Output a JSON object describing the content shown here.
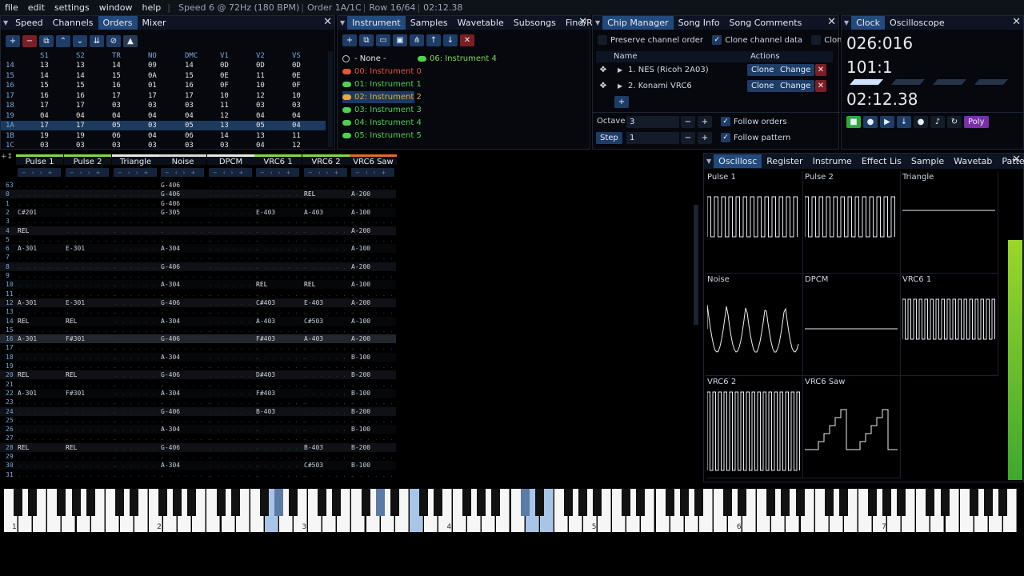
{
  "menu": {
    "items": [
      "file",
      "edit",
      "settings",
      "window",
      "help"
    ],
    "status": [
      "Speed 6 @ 72Hz (180 BPM)",
      "Order 1A/1C",
      "Row 16/64",
      "02:12.38"
    ]
  },
  "orders_panel": {
    "tabs": [
      "Speed",
      "Channels",
      "Orders",
      "Mixer"
    ],
    "columns": [
      "S1",
      "S2",
      "TR",
      "NO",
      "DMC",
      "V1",
      "V2",
      "VS"
    ],
    "rows": [
      {
        "num": "14",
        "vals": [
          "13",
          "13",
          "14",
          "09",
          "14",
          "0D",
          "0D",
          "0D"
        ]
      },
      {
        "num": "15",
        "vals": [
          "14",
          "14",
          "15",
          "0A",
          "15",
          "0E",
          "11",
          "0E"
        ]
      },
      {
        "num": "16",
        "vals": [
          "15",
          "15",
          "16",
          "01",
          "16",
          "0F",
          "10",
          "0F"
        ]
      },
      {
        "num": "17",
        "vals": [
          "16",
          "16",
          "17",
          "17",
          "17",
          "10",
          "12",
          "10"
        ]
      },
      {
        "num": "18",
        "vals": [
          "17",
          "17",
          "03",
          "03",
          "03",
          "11",
          "03",
          "03"
        ]
      },
      {
        "num": "19",
        "vals": [
          "04",
          "04",
          "04",
          "04",
          "04",
          "12",
          "04",
          "04"
        ]
      },
      {
        "num": "1A",
        "vals": [
          "17",
          "17",
          "05",
          "03",
          "05",
          "13",
          "05",
          "04"
        ]
      },
      {
        "num": "1B",
        "vals": [
          "19",
          "19",
          "06",
          "04",
          "06",
          "14",
          "13",
          "11"
        ]
      },
      {
        "num": "1C",
        "vals": [
          "03",
          "03",
          "03",
          "03",
          "03",
          "03",
          "04",
          "12"
        ]
      }
    ]
  },
  "instruments_panel": {
    "tabs": [
      "Instrument",
      "Samples",
      "Wavetable",
      "Subsongs",
      "Find/Repla"
    ],
    "none_label": "- None -",
    "current": "06: Instrument 4",
    "items": [
      {
        "label": "00: Instrument 0",
        "color": "#e0573a"
      },
      {
        "label": "01: Instrument 1",
        "color": "#4fd04f"
      },
      {
        "label": "02: Instrument 2",
        "color": "#e8a83a"
      },
      {
        "label": "03: Instrument 3",
        "color": "#4fd04f"
      },
      {
        "label": "04: Instrument 4",
        "color": "#4fd04f"
      },
      {
        "label": "05: Instrument 5",
        "color": "#4fd04f"
      }
    ]
  },
  "chip_panel": {
    "tabs": [
      "Chip Manager",
      "Song Info",
      "Song Comments"
    ],
    "preserve": "Preserve channel order",
    "clone_data": "Clone channel data",
    "clone_short": "Clone",
    "col_name": "Name",
    "col_actions": "Actions",
    "chips": [
      {
        "name": "1. NES (Ricoh 2A03)",
        "clone": "Clone",
        "change": "Change"
      },
      {
        "name": "2. Konami VRC6",
        "clone": "Clone",
        "change": "Change"
      }
    ],
    "octave_label": "Octave",
    "octave_value": "3",
    "step_label": "Step",
    "step_value": "1",
    "follow_orders": "Follow orders",
    "follow_pattern": "Follow pattern"
  },
  "clock_panel": {
    "tabs": [
      "Clock",
      "Oscilloscope"
    ],
    "ticks": "026:016",
    "beats": "101:1",
    "time": "02:12.38",
    "poly": "Poly"
  },
  "pattern": {
    "channels": [
      {
        "name": "Pulse 1",
        "color": "#7ed957"
      },
      {
        "name": "Pulse 2",
        "color": "#7ed957"
      },
      {
        "name": "Triangle",
        "color": "#e8e8e8"
      },
      {
        "name": "Noise",
        "color": "#d9d9d9"
      },
      {
        "name": "DPCM",
        "color": "#e8e8e8"
      },
      {
        "name": "VRC6 1",
        "color": "#7ed957"
      },
      {
        "name": "VRC6 2",
        "color": "#7ed957"
      },
      {
        "name": "VRC6 Saw",
        "color": "#e06a3a"
      }
    ],
    "rows": [
      {
        "n": "63",
        "c": [
          "",
          "",
          "",
          "G-406",
          "",
          "",
          "",
          ""
        ]
      },
      {
        "n": "0",
        "c": [
          "",
          "",
          "",
          "G-406",
          "",
          "",
          "REL",
          "A-200"
        ]
      },
      {
        "n": "1",
        "c": [
          "",
          "",
          "",
          "G-406",
          "",
          "",
          "",
          ""
        ]
      },
      {
        "n": "2",
        "c": [
          "C#201",
          "",
          "",
          "G-305",
          "",
          "E-403",
          "A-403",
          "A-100"
        ]
      },
      {
        "n": "3",
        "c": [
          "",
          "",
          "",
          "",
          "",
          "",
          "",
          ""
        ]
      },
      {
        "n": "4",
        "c": [
          "REL",
          "",
          "",
          "",
          "",
          "",
          "",
          "A-200"
        ]
      },
      {
        "n": "5",
        "c": [
          "",
          "",
          "",
          "",
          "",
          "",
          "",
          ""
        ]
      },
      {
        "n": "6",
        "c": [
          "A-301",
          "E-301",
          "",
          "A-304",
          "",
          "",
          "",
          "A-100"
        ]
      },
      {
        "n": "7",
        "c": [
          "",
          "",
          "",
          "",
          "",
          "",
          "",
          ""
        ]
      },
      {
        "n": "8",
        "c": [
          "",
          "",
          "",
          "G-406",
          "",
          "",
          "",
          "A-200"
        ]
      },
      {
        "n": "9",
        "c": [
          "",
          "",
          "",
          "",
          "",
          "",
          "",
          ""
        ]
      },
      {
        "n": "10",
        "c": [
          "",
          "",
          "",
          "A-304",
          "",
          "REL",
          "REL",
          "A-100"
        ]
      },
      {
        "n": "11",
        "c": [
          "",
          "",
          "",
          "",
          "",
          "",
          "",
          ""
        ]
      },
      {
        "n": "12",
        "c": [
          "A-301",
          "E-301",
          "",
          "G-406",
          "",
          "C#403",
          "E-403",
          "A-200"
        ]
      },
      {
        "n": "13",
        "c": [
          "",
          "",
          "",
          "",
          "",
          "",
          "",
          ""
        ]
      },
      {
        "n": "14",
        "c": [
          "REL",
          "REL",
          "",
          "A-304",
          "",
          "A-403",
          "C#503",
          "A-100"
        ]
      },
      {
        "n": "15",
        "c": [
          "",
          "",
          "",
          "",
          "",
          "",
          "",
          ""
        ]
      },
      {
        "n": "16",
        "c": [
          "A-301",
          "F#301",
          "",
          "G-406",
          "",
          "F#403",
          "A-403",
          "A-200"
        ]
      },
      {
        "n": "17",
        "c": [
          "",
          "",
          "",
          "",
          "",
          "",
          "",
          ""
        ]
      },
      {
        "n": "18",
        "c": [
          "",
          "",
          "",
          "A-304",
          "",
          "",
          "",
          "B-100"
        ]
      },
      {
        "n": "19",
        "c": [
          "",
          "",
          "",
          "",
          "",
          "",
          "",
          ""
        ]
      },
      {
        "n": "20",
        "c": [
          "REL",
          "REL",
          "",
          "G-406",
          "",
          "D#403",
          "",
          "B-200"
        ]
      },
      {
        "n": "21",
        "c": [
          "",
          "",
          "",
          "",
          "",
          "",
          "",
          ""
        ]
      },
      {
        "n": "22",
        "c": [
          "A-301",
          "F#301",
          "",
          "A-304",
          "",
          "F#403",
          "",
          "B-100"
        ]
      },
      {
        "n": "23",
        "c": [
          "",
          "",
          "",
          "",
          "",
          "",
          "",
          ""
        ]
      },
      {
        "n": "24",
        "c": [
          "",
          "",
          "",
          "G-406",
          "",
          "B-403",
          "",
          "B-200"
        ]
      },
      {
        "n": "25",
        "c": [
          "",
          "",
          "",
          "",
          "",
          "",
          "",
          ""
        ]
      },
      {
        "n": "26",
        "c": [
          "",
          "",
          "",
          "A-304",
          "",
          "",
          "",
          "B-100"
        ]
      },
      {
        "n": "27",
        "c": [
          "",
          "",
          "",
          "",
          "",
          "",
          "",
          ""
        ]
      },
      {
        "n": "28",
        "c": [
          "REL",
          "REL",
          "",
          "G-406",
          "",
          "",
          "B-403",
          "B-200"
        ]
      },
      {
        "n": "29",
        "c": [
          "",
          "",
          "",
          "",
          "",
          "",
          "",
          ""
        ]
      },
      {
        "n": "30",
        "c": [
          "",
          "",
          "",
          "A-304",
          "",
          "",
          "C#503",
          "B-100"
        ]
      },
      {
        "n": "31",
        "c": [
          "",
          "",
          "",
          "",
          "",
          "",
          "",
          ""
        ]
      }
    ]
  },
  "osc_panel": {
    "tabs": [
      "Oscillosc",
      "Register",
      "Instrume",
      "Effect Lis",
      "Sample",
      "Wavetab",
      "Pattern"
    ],
    "labels": [
      "Pulse 1",
      "Pulse 2",
      "Triangle",
      "Noise",
      "DPCM",
      "VRC6 1",
      "VRC6 2",
      "VRC6 Saw"
    ]
  },
  "keyboard": {
    "octaves": [
      "1",
      "2",
      "3",
      "4",
      "5",
      "6",
      "7"
    ]
  }
}
